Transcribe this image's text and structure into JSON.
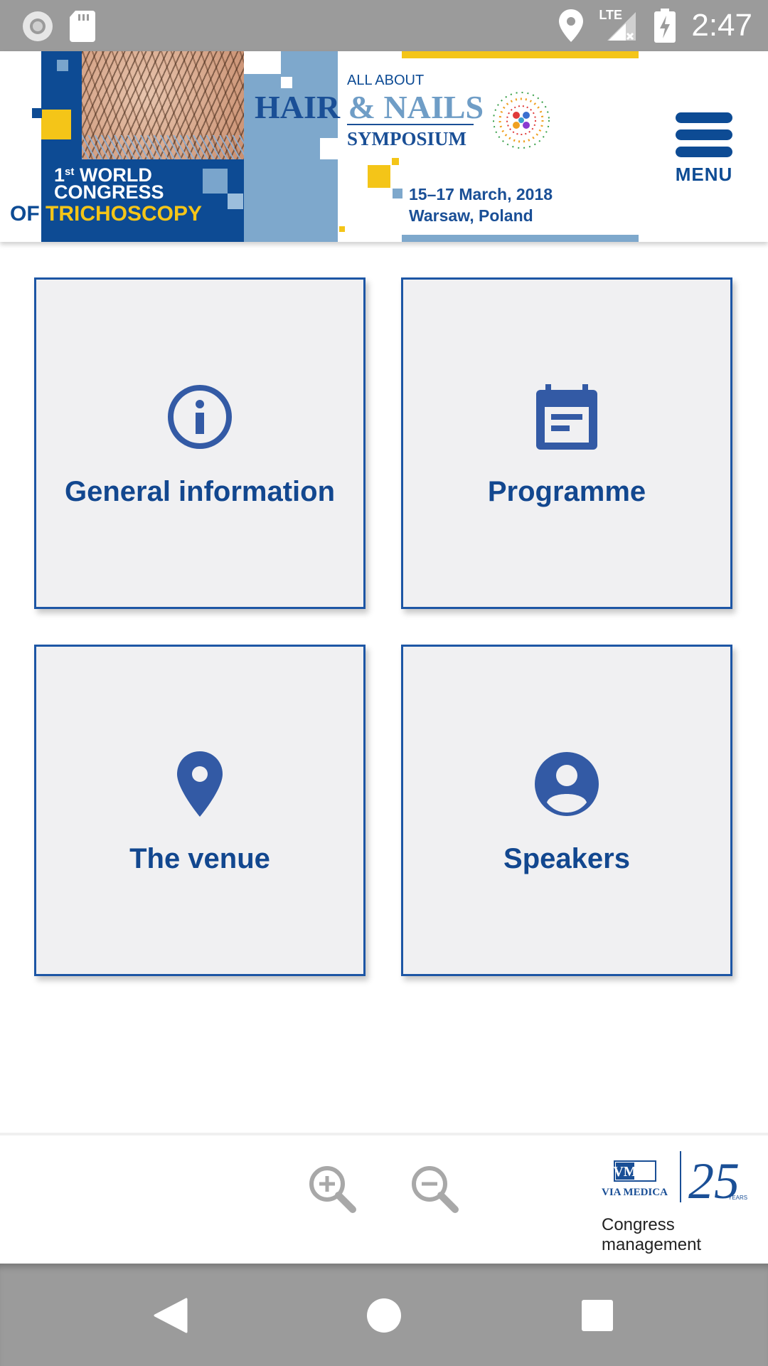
{
  "status_bar": {
    "time": "2:47",
    "network": "LTE",
    "icons": [
      "record-icon",
      "sd-card-icon",
      "location-icon",
      "signal-icon",
      "battery-charging-icon"
    ]
  },
  "header": {
    "banner": {
      "congress_line1": "1",
      "congress_sup": "st",
      "congress_line1_rest": " WORLD",
      "congress_line2": "CONGRESS",
      "of": "OF ",
      "trichoscopy": "TRICHOSCOPY",
      "all_about": "ALL ABOUT",
      "hair": "HAIR ",
      "nails": "& NAILS",
      "symposium": "SYMPOSIUM",
      "date": "15–17 March, 2018",
      "place": "Warsaw, Poland"
    },
    "menu_label": "MENU"
  },
  "tiles": [
    {
      "label": "General information",
      "icon": "info-icon"
    },
    {
      "label": "Programme",
      "icon": "calendar-icon"
    },
    {
      "label": "The venue",
      "icon": "location-pin-icon"
    },
    {
      "label": "Speakers",
      "icon": "person-icon"
    }
  ],
  "footer": {
    "zoom_in_icon": "zoom-in-icon",
    "zoom_out_icon": "zoom-out-icon",
    "logo_vm": "VM",
    "logo_brand": "VIA MEDICA",
    "logo_years_num": "25",
    "logo_years_label": "YEARS",
    "tagline_line1": "Congress",
    "tagline_line2": "management"
  },
  "colors": {
    "primary": "#12478f",
    "tile_border": "#1d56a5",
    "tile_bg": "#f0f0f2",
    "accent_yellow": "#f4c518",
    "status_bar": "#9b9b9b"
  }
}
